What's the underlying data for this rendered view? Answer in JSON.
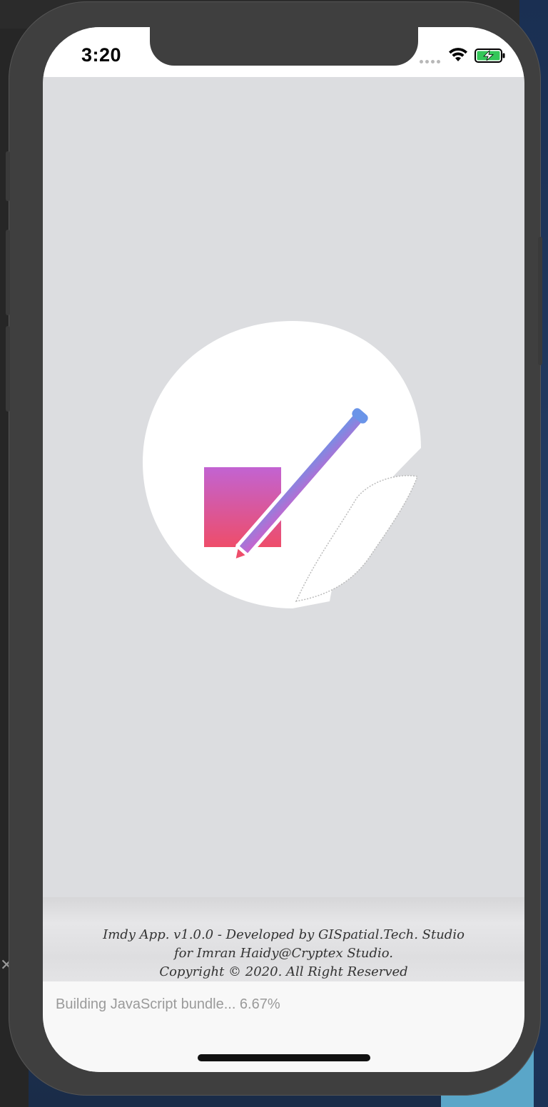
{
  "status_bar": {
    "time": "3:20",
    "signal_icon": "cellular-dots-icon",
    "wifi_icon": "wifi-icon",
    "battery_icon": "battery-charging-icon",
    "battery_color": "#34c759"
  },
  "splash": {
    "logo_icon": "image-edit-logo-icon",
    "background_color": "#dcdde0"
  },
  "footer": {
    "line1": "Imdy App. v1.0.0 - Developed by GISpatial.Tech. Studio",
    "line2": "for Imran Haidy@Cryptex Studio.",
    "line3": "Copyright © 2020. All Right Reserved"
  },
  "bundle_status": {
    "text": "Building JavaScript bundle... 6.67%",
    "progress_percent": 6.67
  }
}
